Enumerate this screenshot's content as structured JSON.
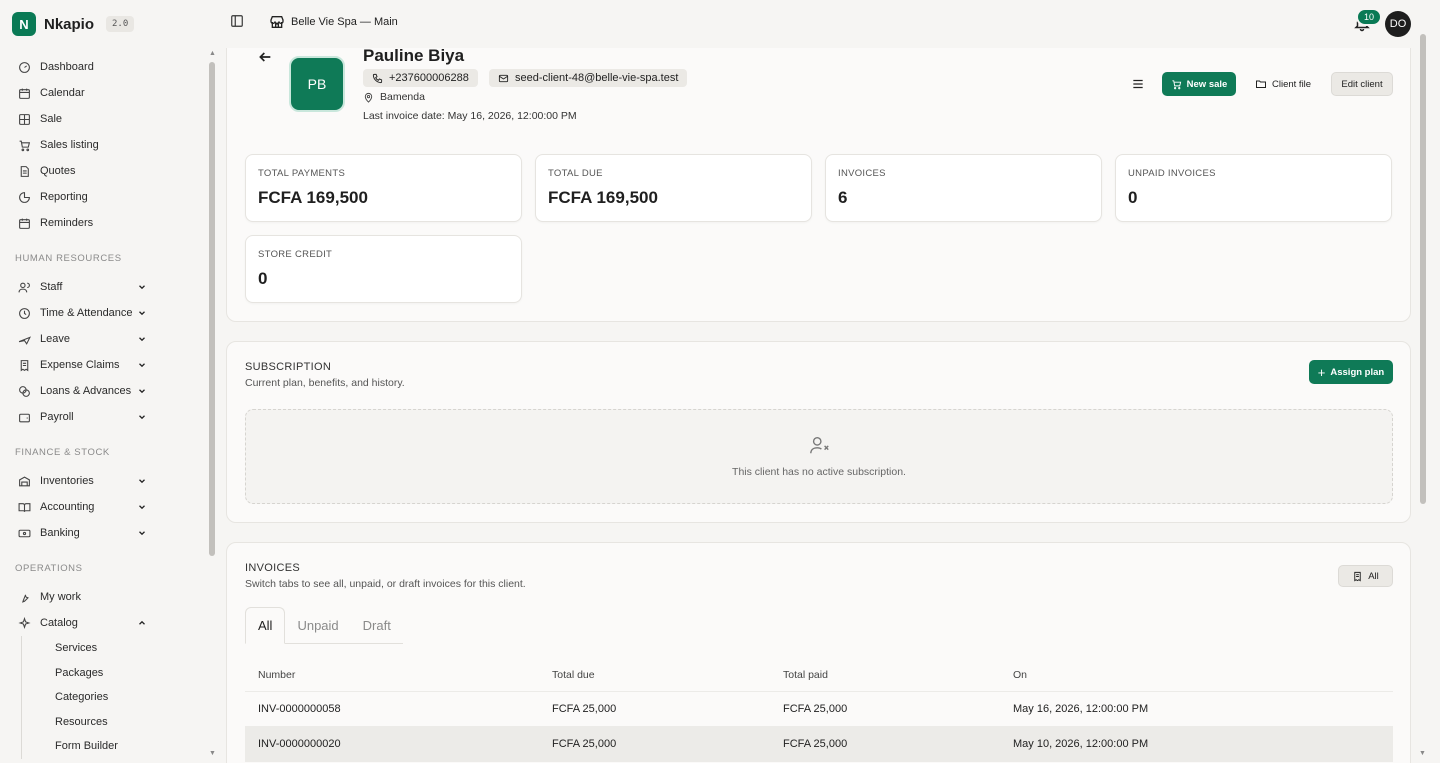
{
  "app": {
    "name": "Nkapio",
    "version": "2.0"
  },
  "topbar": {
    "store": "Belle Vie Spa — Main",
    "notif_count": "10",
    "user_initials": "DO"
  },
  "nav": {
    "main": [
      "Dashboard",
      "Calendar",
      "Sale",
      "Sales listing",
      "Quotes",
      "Reporting",
      "Reminders"
    ],
    "hr_title": "HUMAN RESOURCES",
    "hr": [
      "Staff",
      "Time & Attendance",
      "Leave",
      "Expense Claims",
      "Loans & Advances",
      "Payroll"
    ],
    "fin_title": "FINANCE & STOCK",
    "fin": [
      "Inventories",
      "Accounting",
      "Banking"
    ],
    "ops_title": "OPERATIONS",
    "ops": [
      "My work",
      "Catalog"
    ],
    "catalog_sub": [
      "Services",
      "Packages",
      "Categories",
      "Resources",
      "Form Builder"
    ]
  },
  "client": {
    "name": "Pauline Biya",
    "initials": "PB",
    "phone": "+237600006288",
    "email": "seed-client-48@belle-vie-spa.test",
    "location": "Bamenda",
    "last_invoice": "Last invoice date: May 16, 2026, 12:00:00 PM"
  },
  "actions": {
    "new_sale": "New sale",
    "client_file": "Client file",
    "edit_client": "Edit client"
  },
  "stats": [
    {
      "label": "TOTAL PAYMENTS",
      "value": "FCFA 169,500"
    },
    {
      "label": "TOTAL DUE",
      "value": "FCFA 169,500"
    },
    {
      "label": "INVOICES",
      "value": "6"
    },
    {
      "label": "UNPAID INVOICES",
      "value": "0"
    },
    {
      "label": "STORE CREDIT",
      "value": "0"
    }
  ],
  "subscription": {
    "title": "SUBSCRIPTION",
    "subtitle": "Current plan, benefits, and history.",
    "assign_label": "Assign plan",
    "empty_text": "This client has no active subscription."
  },
  "invoices": {
    "title": "INVOICES",
    "subtitle": "Switch tabs to see all, unpaid, or draft invoices for this client.",
    "filter_label": "All",
    "tabs": [
      "All",
      "Unpaid",
      "Draft"
    ],
    "columns": [
      "Number",
      "Total due",
      "Total paid",
      "On"
    ],
    "rows": [
      [
        "INV-0000000058",
        "FCFA 25,000",
        "FCFA 25,000",
        "May 16, 2026, 12:00:00 PM"
      ],
      [
        "INV-0000000020",
        "FCFA 25,000",
        "FCFA 25,000",
        "May 10, 2026, 12:00:00 PM"
      ]
    ]
  },
  "colors": {
    "accent": "#0f7a57",
    "background": "#f6f5f3"
  }
}
